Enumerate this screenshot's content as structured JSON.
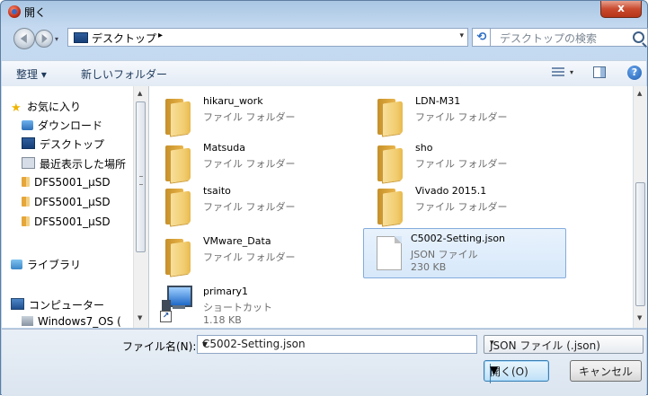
{
  "window": {
    "title": "開く",
    "close_glyph": "x"
  },
  "address": {
    "location": "デスクトップ",
    "arrow": "▸"
  },
  "search": {
    "placeholder": "デスクトップの検索"
  },
  "toolbar": {
    "organize": "整理 ▾",
    "new_folder": "新しいフォルダー"
  },
  "nav": {
    "items": [
      {
        "label": "お気に入り",
        "icon": "star-icon"
      },
      {
        "label": "ダウンロード",
        "icon": "download-icon"
      },
      {
        "label": "デスクトップ",
        "icon": "desktop-icon"
      },
      {
        "label": "最近表示した場所",
        "icon": "recent-places-icon"
      },
      {
        "label": "DFS5001_µSD",
        "icon": "folder-icon"
      },
      {
        "label": "DFS5001_µSD",
        "icon": "folder-icon"
      },
      {
        "label": "DFS5001_µSD",
        "icon": "folder-icon"
      },
      {
        "label": "ライブラリ",
        "icon": "library-icon"
      },
      {
        "label": "コンピューター",
        "icon": "computer-icon"
      },
      {
        "label": "Windows7_OS (",
        "icon": "drive-icon"
      }
    ]
  },
  "files": [
    {
      "name": "hikaru_work",
      "type": "ファイル フォルダー",
      "icon": "folder-icon"
    },
    {
      "name": "LDN-M31",
      "type": "ファイル フォルダー",
      "icon": "folder-icon"
    },
    {
      "name": "Matsuda",
      "type": "ファイル フォルダー",
      "icon": "folder-icon"
    },
    {
      "name": "sho",
      "type": "ファイル フォルダー",
      "icon": "folder-icon"
    },
    {
      "name": "tsaito",
      "type": "ファイル フォルダー",
      "icon": "folder-icon"
    },
    {
      "name": "Vivado 2015.1",
      "type": "ファイル フォルダー",
      "icon": "folder-icon"
    },
    {
      "name": "VMware_Data",
      "type": "ファイル フォルダー",
      "icon": "folder-icon"
    },
    {
      "name": "C5002-Setting.json",
      "type": "JSON ファイル",
      "size": "230 KB",
      "icon": "json-file-icon",
      "selected": true
    },
    {
      "name": "primary1",
      "type": "ショートカット",
      "size": "1.18 KB",
      "icon": "shortcut-icon"
    }
  ],
  "footer": {
    "filename_label": "ファイル名(N):",
    "filename_value": "C5002-Setting.json",
    "filetype_value": "JSON ファイル (.json)",
    "open_label": "開く(O)",
    "cancel_label": "キャンセル"
  }
}
